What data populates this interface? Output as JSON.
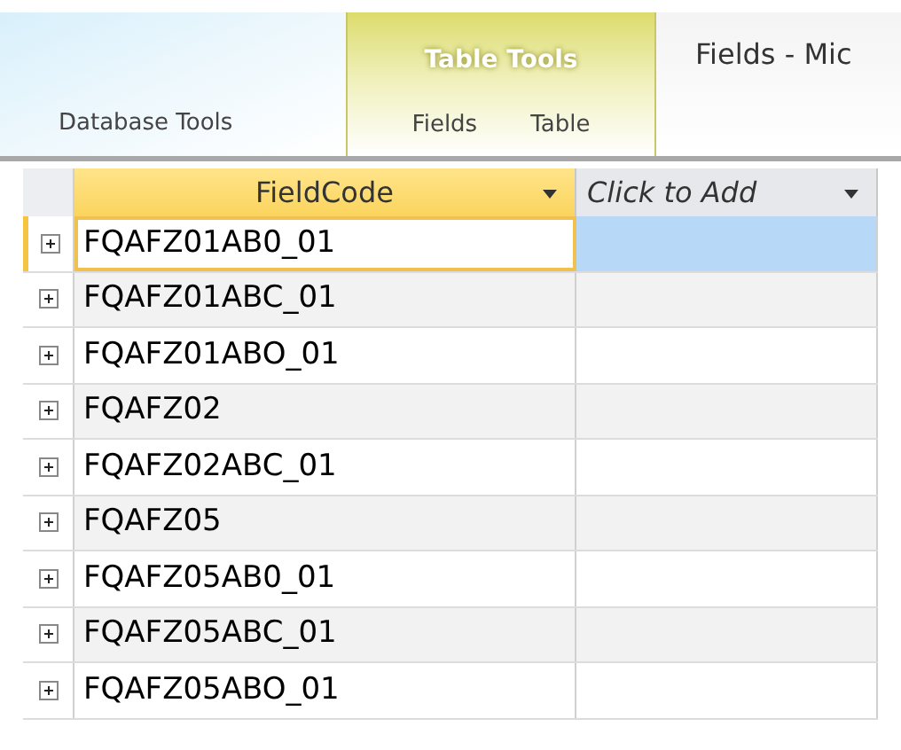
{
  "ribbon": {
    "contextual_group": "Table Tools",
    "tabs": [
      {
        "label": "Database Tools",
        "selected": false
      },
      {
        "label": "Fields",
        "selected": false
      },
      {
        "label": "Table",
        "selected": false
      }
    ],
    "window_title": "Fields - Mic"
  },
  "table": {
    "columns": [
      {
        "label": "FieldCode",
        "selected": true
      },
      {
        "label": "Click to Add",
        "selected": false
      }
    ],
    "rows": [
      {
        "field_code": "FQAFZ01AB0_01",
        "selected": true
      },
      {
        "field_code": "FQAFZ01ABC_01",
        "selected": false
      },
      {
        "field_code": "FQAFZ01ABO_01",
        "selected": false
      },
      {
        "field_code": "FQAFZ02",
        "selected": false
      },
      {
        "field_code": "FQAFZ02ABC_01",
        "selected": false
      },
      {
        "field_code": "FQAFZ05",
        "selected": false
      },
      {
        "field_code": "FQAFZ05AB0_01",
        "selected": false
      },
      {
        "field_code": "FQAFZ05ABC_01",
        "selected": false
      },
      {
        "field_code": "FQAFZ05ABO_01",
        "selected": false
      }
    ]
  }
}
